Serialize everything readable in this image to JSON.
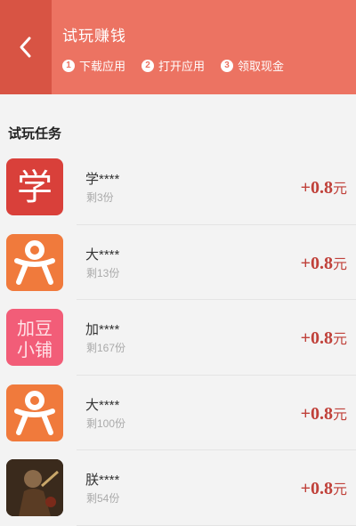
{
  "header": {
    "title": "试玩赚钱",
    "steps": [
      {
        "num": "1",
        "label": "下载应用"
      },
      {
        "num": "2",
        "label": "打开应用"
      },
      {
        "num": "3",
        "label": "领取现金"
      }
    ]
  },
  "section_title": "试玩任务",
  "tasks": [
    {
      "name": "学****",
      "remaining": "剩3份",
      "reward": "0.8",
      "icon": "xue-app-icon"
    },
    {
      "name": "大****",
      "remaining": "剩13份",
      "reward": "0.8",
      "icon": "person-app-icon"
    },
    {
      "name": "加****",
      "remaining": "剩167份",
      "reward": "0.8",
      "icon": "soy-app-icon"
    },
    {
      "name": "大****",
      "remaining": "剩100份",
      "reward": "0.8",
      "icon": "person-app-icon"
    },
    {
      "name": "朕****",
      "remaining": "剩54份",
      "reward": "0.8",
      "icon": "game-app-icon"
    }
  ],
  "reward_prefix": "+",
  "reward_unit": "元",
  "icons": {
    "xue_label": "学",
    "soy_label_line1": "加豆",
    "soy_label_line2": "小铺"
  },
  "colors": {
    "header": "#ec7362",
    "back_button": "#d85444",
    "reward": "#c0413a",
    "xue_icon": "#d9403a",
    "person_icon": "#f07a3c",
    "soy_icon": "#f25d78"
  }
}
